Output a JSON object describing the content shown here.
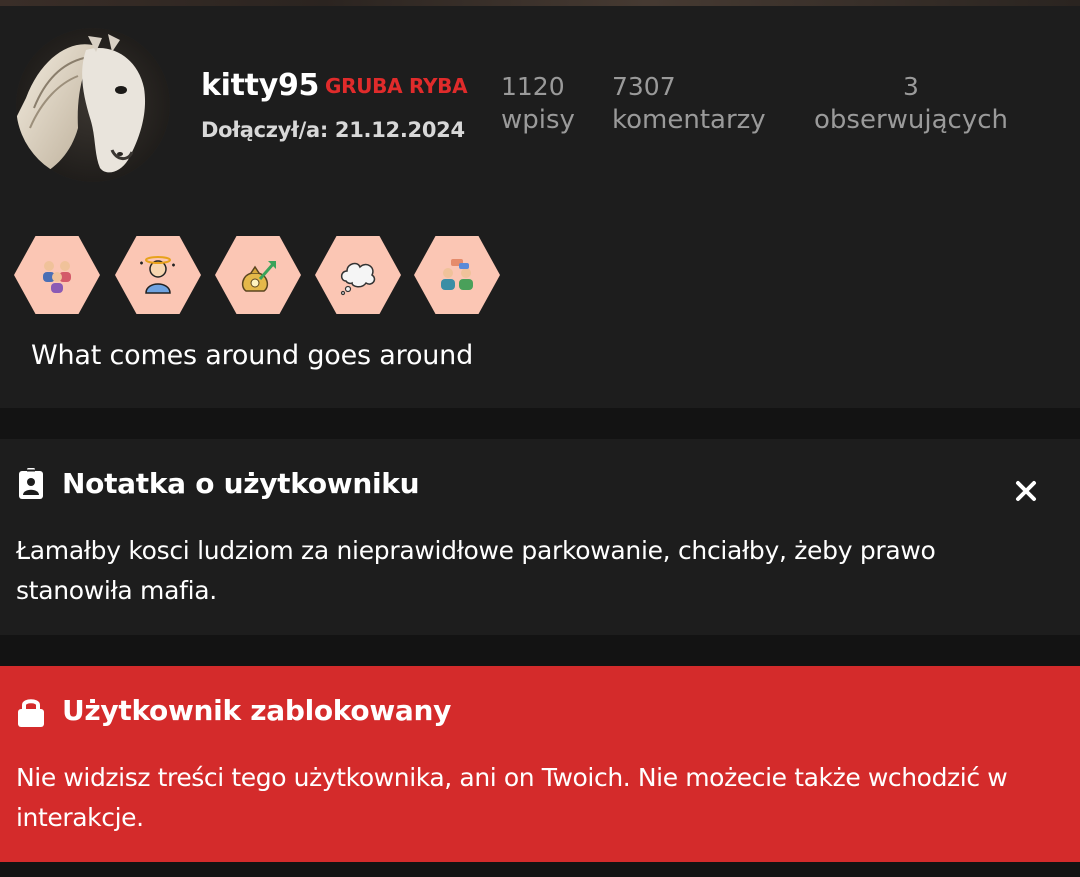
{
  "profile": {
    "username": "kitty95",
    "rank": "GRUBA RYBA",
    "joined": "Dołączył/a: 21.12.2024",
    "stats": {
      "posts_count": "1120",
      "posts_label": "wpisy",
      "comments_count": "7307",
      "comments_label": "komentarzy",
      "followers_count": "3",
      "followers_label": "obserwujących"
    },
    "badges": [
      "people-group-icon",
      "dizzy-person-icon",
      "money-bag-growth-icon",
      "thought-cloud-icon",
      "people-talking-icon"
    ],
    "motto": "What comes around goes around"
  },
  "note": {
    "title": "Notatka o użytkowniku",
    "text": "Łamałby kosci ludziom za nieprawidłowe parkowanie, chciałby, żeby prawo stanowiła mafia."
  },
  "blocked": {
    "title": "Użytkownik zablokowany",
    "text": "Nie widzisz treści tego użytkownika, ani on Twoich. Nie możecie także wchodzić w interakcje."
  },
  "colors": {
    "background": "#131313",
    "card": "#1d1d1d",
    "rank_red": "#e02b2b",
    "blocked_red": "#d42b2b",
    "badge_bg": "#fbc6b4",
    "stat_gray": "#9a9a9a"
  }
}
